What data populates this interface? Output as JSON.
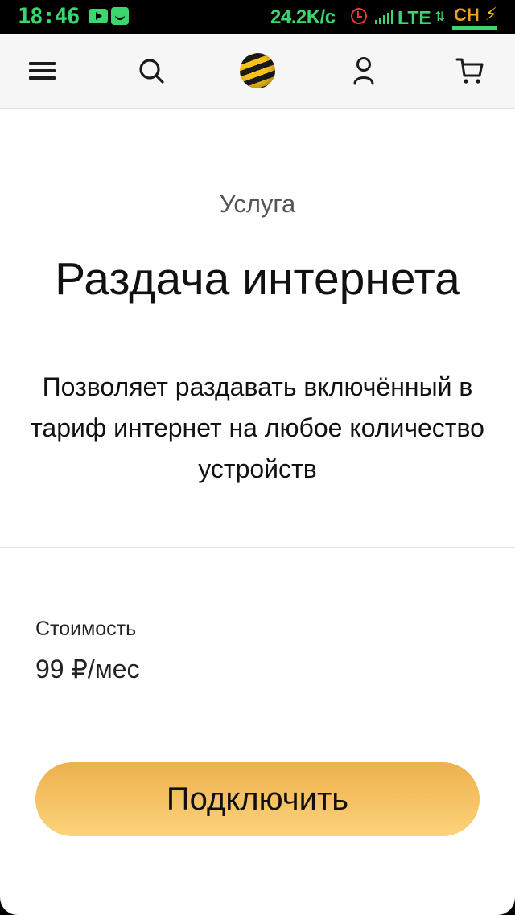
{
  "status_bar": {
    "time": "18:46",
    "net_speed": "24.2K/с",
    "network": "LTE",
    "battery_label": "CH",
    "icons": [
      "youtube-icon",
      "messenger-icon",
      "alarm-icon",
      "signal-icon",
      "data-arrows-icon",
      "battery-icon",
      "charging-icon"
    ],
    "accent_color": "#3bd66d"
  },
  "app_bar": {
    "icons": [
      "menu-icon",
      "search-icon",
      "beeline-logo",
      "profile-icon",
      "cart-icon"
    ],
    "brand_color": "#f6c21a"
  },
  "service": {
    "label": "Услуга",
    "title": "Раздача интернета",
    "description": "Позволяет раздавать включённый в тариф интернет на любое количество устройств"
  },
  "price": {
    "label": "Стоимость",
    "value": "99 ₽/мес"
  },
  "actions": {
    "connect_label": "Подключить",
    "button_color": "#f5c66a"
  }
}
